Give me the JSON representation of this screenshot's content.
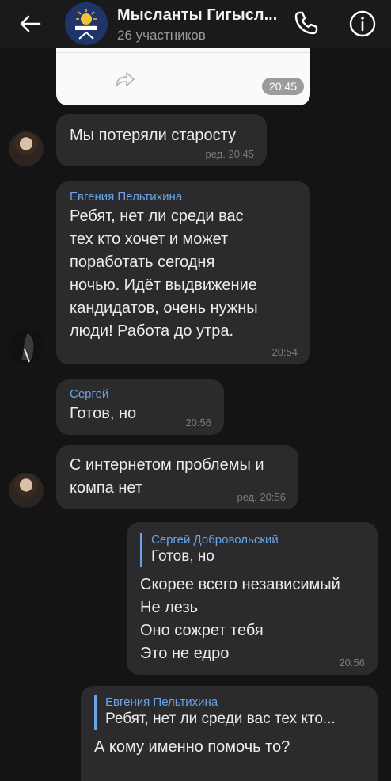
{
  "header": {
    "title": "Мысланты Гигысл...",
    "subtitle": "26 участников"
  },
  "messages": [
    {
      "ts": "20:45"
    },
    {
      "text": "Мы потеряли старосту",
      "time": "ред. 20:45"
    },
    {
      "sender": "Евгения Пельтихина",
      "lines": [
        "Ребят, нет ли среди вас",
        "тех кто хочет и может",
        "поработать сегодня",
        "ночью. Идёт выдвижение",
        "кандидатов, очень нужны",
        "люди! Работа до утра."
      ],
      "time": "20:54"
    },
    {
      "sender": "Сергей",
      "text": "Готов, но",
      "time": "20:56"
    },
    {
      "lines": [
        "С интернетом проблемы и",
        "компа нет"
      ],
      "time": "ред. 20:56"
    },
    {
      "quote_name": "Сергей Добровольский",
      "quote_text": "Готов, но",
      "lines": [
        "Скорее всего независимый",
        "Не лезь",
        "Оно сожрет тебя",
        "Это не едро"
      ],
      "time": "20:56"
    },
    {
      "quote_name": "Евгения Пельтихина",
      "quote_text": "Ребят, нет ли среди вас тех кто...",
      "text": "А кому именно помочь то?"
    }
  ]
}
